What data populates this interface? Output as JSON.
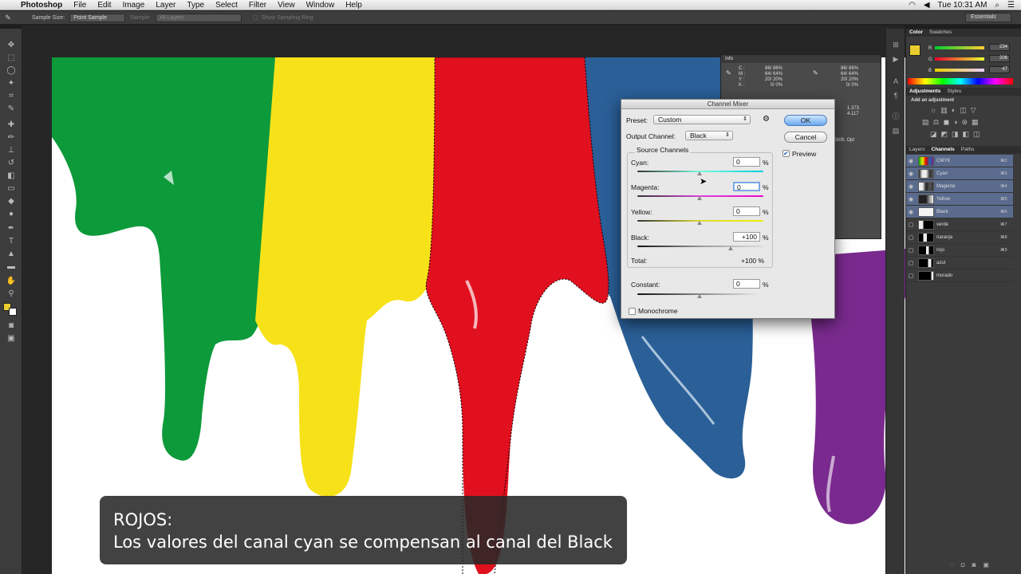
{
  "menubar": {
    "app_name": "Photoshop",
    "items": [
      "File",
      "Edit",
      "Image",
      "Layer",
      "Type",
      "Select",
      "Filter",
      "View",
      "Window",
      "Help"
    ],
    "time": "Tue 10:31 AM"
  },
  "options_bar": {
    "sample_size_label": "Sample Size:",
    "sample_size_value": "Point Sample",
    "sample_label": "Sample:",
    "sample_value": "All Layers",
    "show_ring_label": "Show Sampling Ring",
    "workspace_value": "Essentials"
  },
  "info_panel": {
    "title": "Info",
    "hint": "Shift, Opt",
    "c1_label": "C :",
    "c1": "86/ 86%",
    "m1_label": "M :",
    "m1": "64/ 64%",
    "y1_label": "Y :",
    "y1": "20/ 20%",
    "k1_label": "K :",
    "k1": "0/ 0%",
    "c2": "86/ 86%",
    "m2": "64/ 64%",
    "y2": "20/ 20%",
    "k2": "0/ 0%",
    "w": "1.373",
    "h": "4.117"
  },
  "dialog": {
    "title": "Channel Mixer",
    "preset_label": "Preset:",
    "preset_value": "Custom",
    "output_label": "Output Channel:",
    "output_value": "Black",
    "ok_label": "OK",
    "cancel_label": "Cancel",
    "preview_label": "Preview",
    "preview_checked": true,
    "group_label": "Source Channels",
    "cyan_label": "Cyan:",
    "cyan_value": "0",
    "magenta_label": "Magenta:",
    "magenta_value": "0",
    "yellow_label": "Yellow:",
    "yellow_value": "0",
    "black_label": "Black:",
    "black_value": "+100",
    "total_label": "Total:",
    "total_value": "+100 %",
    "constant_label": "Constant:",
    "constant_value": "0",
    "pct": "%",
    "monochrome_label": "Monochrome",
    "monochrome_checked": false
  },
  "color_panel": {
    "tabs": [
      "Color",
      "Swatches"
    ],
    "r_label": "R",
    "r": "234",
    "g_label": "G",
    "g": "206",
    "b_label": "B",
    "b": "47",
    "fg_color": "#eace2f"
  },
  "adjust_panel": {
    "tabs": [
      "Adjustments",
      "Styles"
    ],
    "hint": "Add an adjustment"
  },
  "channels_panel": {
    "tabs": [
      "Layers",
      "Channels",
      "Paths"
    ],
    "rows": [
      {
        "name": "CMYK",
        "shortcut": "⌘2",
        "selected": true
      },
      {
        "name": "Cyan",
        "shortcut": "⌘3",
        "selected": true
      },
      {
        "name": "Magenta",
        "shortcut": "⌘4",
        "selected": true
      },
      {
        "name": "Yellow",
        "shortcut": "⌘5",
        "selected": true
      },
      {
        "name": "Black",
        "shortcut": "⌘6",
        "selected": true
      },
      {
        "name": "verde",
        "shortcut": "⌘7",
        "selected": false
      },
      {
        "name": "naranja",
        "shortcut": "⌘8",
        "selected": false
      },
      {
        "name": "rojo",
        "shortcut": "⌘9",
        "selected": false
      },
      {
        "name": "azul",
        "shortcut": "",
        "selected": false
      },
      {
        "name": "morado",
        "shortcut": "",
        "selected": false
      }
    ]
  },
  "caption": {
    "line1": "ROJOS:",
    "line2": "Los valores del canal cyan se compensan al canal del Black"
  },
  "colors": {
    "green": "#0c9a3a",
    "yellow": "#f7e21a",
    "red": "#e0101f",
    "blue": "#2a5f97",
    "purple": "#7a2a8e"
  }
}
